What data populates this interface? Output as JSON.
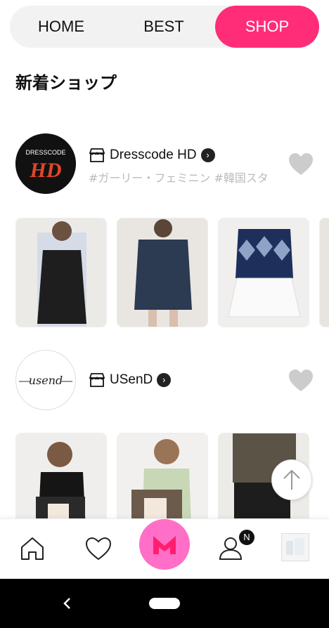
{
  "tabs": {
    "home": "HOME",
    "best": "BEST",
    "shop": "SHOP"
  },
  "section_title": "新着ショップ",
  "shops": [
    {
      "name": "Dresscode HD",
      "tags": "#ガーリー・フェミニン  #韓国スタ",
      "logo_text_small": "DRESSCODE",
      "logo_text_big": "HD"
    },
    {
      "name": "USenD",
      "tags": "",
      "logo_text": "usend"
    }
  ],
  "bottom_nav": {
    "badge": "N"
  },
  "colors": {
    "accent": "#ff2d78",
    "m_button": "#ff6ec7",
    "heart": "#cccccc"
  }
}
